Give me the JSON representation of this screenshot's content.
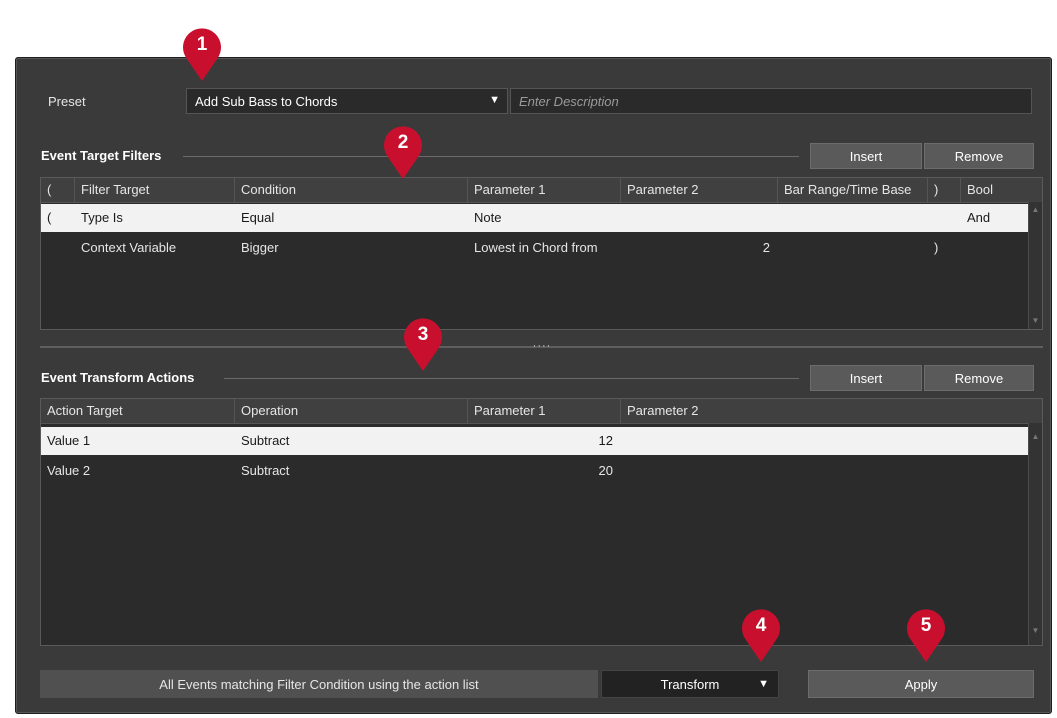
{
  "preset": {
    "label": "Preset",
    "selected": "Add Sub Bass to Chords",
    "description_placeholder": "Enter Description"
  },
  "filters": {
    "title": "Event Target Filters",
    "insert_label": "Insert",
    "remove_label": "Remove",
    "columns": [
      "(",
      "Filter Target",
      "Condition",
      "Parameter 1",
      "Parameter 2",
      "Bar Range/Time Base",
      ")",
      "Bool"
    ],
    "rows": [
      {
        "open": "(",
        "target": "Type Is",
        "condition": "Equal",
        "param1": "Note",
        "param2": "",
        "range": "",
        "close": "",
        "bool": "And"
      },
      {
        "open": "",
        "target": "Context Variable",
        "condition": "Bigger",
        "param1": "Lowest in Chord from",
        "param2": "2",
        "range": "",
        "close": ")",
        "bool": ""
      }
    ]
  },
  "actions": {
    "title": "Event Transform Actions",
    "insert_label": "Insert",
    "remove_label": "Remove",
    "columns": [
      "Action Target",
      "Operation",
      "Parameter 1",
      "Parameter 2"
    ],
    "rows": [
      {
        "target": "Value 1",
        "operation": "Subtract",
        "param1": "12",
        "param2": ""
      },
      {
        "target": "Value 2",
        "operation": "Subtract",
        "param1": "20",
        "param2": ""
      }
    ]
  },
  "footer": {
    "description": "All Events matching Filter Condition using the action list",
    "function_selected": "Transform",
    "apply_label": "Apply"
  },
  "markers": [
    "1",
    "2",
    "3",
    "4",
    "5"
  ],
  "colors": {
    "panel": "#3a3a3a",
    "marker": "#c8102e",
    "selected_row": "#f2f2f2"
  }
}
